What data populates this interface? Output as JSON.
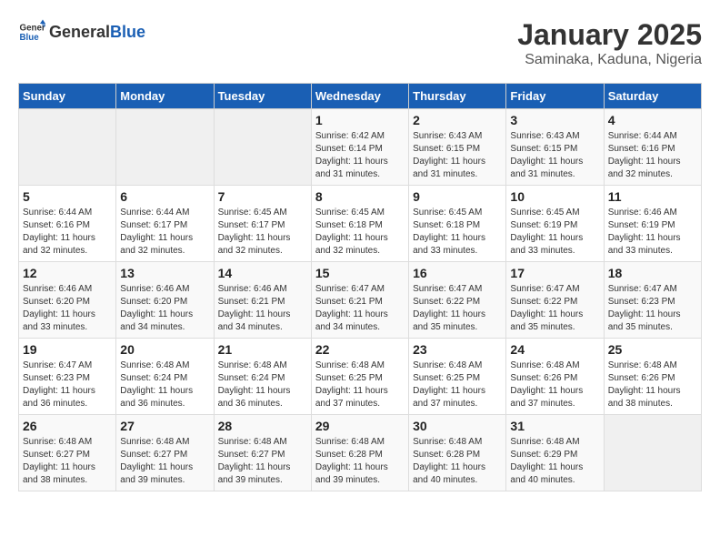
{
  "logo": {
    "text_general": "General",
    "text_blue": "Blue"
  },
  "title": "January 2025",
  "subtitle": "Saminaka, Kaduna, Nigeria",
  "days_of_week": [
    "Sunday",
    "Monday",
    "Tuesday",
    "Wednesday",
    "Thursday",
    "Friday",
    "Saturday"
  ],
  "weeks": [
    [
      {
        "day": "",
        "info": ""
      },
      {
        "day": "",
        "info": ""
      },
      {
        "day": "",
        "info": ""
      },
      {
        "day": "1",
        "info": "Sunrise: 6:42 AM\nSunset: 6:14 PM\nDaylight: 11 hours and 31 minutes."
      },
      {
        "day": "2",
        "info": "Sunrise: 6:43 AM\nSunset: 6:15 PM\nDaylight: 11 hours and 31 minutes."
      },
      {
        "day": "3",
        "info": "Sunrise: 6:43 AM\nSunset: 6:15 PM\nDaylight: 11 hours and 31 minutes."
      },
      {
        "day": "4",
        "info": "Sunrise: 6:44 AM\nSunset: 6:16 PM\nDaylight: 11 hours and 32 minutes."
      }
    ],
    [
      {
        "day": "5",
        "info": "Sunrise: 6:44 AM\nSunset: 6:16 PM\nDaylight: 11 hours and 32 minutes."
      },
      {
        "day": "6",
        "info": "Sunrise: 6:44 AM\nSunset: 6:17 PM\nDaylight: 11 hours and 32 minutes."
      },
      {
        "day": "7",
        "info": "Sunrise: 6:45 AM\nSunset: 6:17 PM\nDaylight: 11 hours and 32 minutes."
      },
      {
        "day": "8",
        "info": "Sunrise: 6:45 AM\nSunset: 6:18 PM\nDaylight: 11 hours and 32 minutes."
      },
      {
        "day": "9",
        "info": "Sunrise: 6:45 AM\nSunset: 6:18 PM\nDaylight: 11 hours and 33 minutes."
      },
      {
        "day": "10",
        "info": "Sunrise: 6:45 AM\nSunset: 6:19 PM\nDaylight: 11 hours and 33 minutes."
      },
      {
        "day": "11",
        "info": "Sunrise: 6:46 AM\nSunset: 6:19 PM\nDaylight: 11 hours and 33 minutes."
      }
    ],
    [
      {
        "day": "12",
        "info": "Sunrise: 6:46 AM\nSunset: 6:20 PM\nDaylight: 11 hours and 33 minutes."
      },
      {
        "day": "13",
        "info": "Sunrise: 6:46 AM\nSunset: 6:20 PM\nDaylight: 11 hours and 34 minutes."
      },
      {
        "day": "14",
        "info": "Sunrise: 6:46 AM\nSunset: 6:21 PM\nDaylight: 11 hours and 34 minutes."
      },
      {
        "day": "15",
        "info": "Sunrise: 6:47 AM\nSunset: 6:21 PM\nDaylight: 11 hours and 34 minutes."
      },
      {
        "day": "16",
        "info": "Sunrise: 6:47 AM\nSunset: 6:22 PM\nDaylight: 11 hours and 35 minutes."
      },
      {
        "day": "17",
        "info": "Sunrise: 6:47 AM\nSunset: 6:22 PM\nDaylight: 11 hours and 35 minutes."
      },
      {
        "day": "18",
        "info": "Sunrise: 6:47 AM\nSunset: 6:23 PM\nDaylight: 11 hours and 35 minutes."
      }
    ],
    [
      {
        "day": "19",
        "info": "Sunrise: 6:47 AM\nSunset: 6:23 PM\nDaylight: 11 hours and 36 minutes."
      },
      {
        "day": "20",
        "info": "Sunrise: 6:48 AM\nSunset: 6:24 PM\nDaylight: 11 hours and 36 minutes."
      },
      {
        "day": "21",
        "info": "Sunrise: 6:48 AM\nSunset: 6:24 PM\nDaylight: 11 hours and 36 minutes."
      },
      {
        "day": "22",
        "info": "Sunrise: 6:48 AM\nSunset: 6:25 PM\nDaylight: 11 hours and 37 minutes."
      },
      {
        "day": "23",
        "info": "Sunrise: 6:48 AM\nSunset: 6:25 PM\nDaylight: 11 hours and 37 minutes."
      },
      {
        "day": "24",
        "info": "Sunrise: 6:48 AM\nSunset: 6:26 PM\nDaylight: 11 hours and 37 minutes."
      },
      {
        "day": "25",
        "info": "Sunrise: 6:48 AM\nSunset: 6:26 PM\nDaylight: 11 hours and 38 minutes."
      }
    ],
    [
      {
        "day": "26",
        "info": "Sunrise: 6:48 AM\nSunset: 6:27 PM\nDaylight: 11 hours and 38 minutes."
      },
      {
        "day": "27",
        "info": "Sunrise: 6:48 AM\nSunset: 6:27 PM\nDaylight: 11 hours and 39 minutes."
      },
      {
        "day": "28",
        "info": "Sunrise: 6:48 AM\nSunset: 6:27 PM\nDaylight: 11 hours and 39 minutes."
      },
      {
        "day": "29",
        "info": "Sunrise: 6:48 AM\nSunset: 6:28 PM\nDaylight: 11 hours and 39 minutes."
      },
      {
        "day": "30",
        "info": "Sunrise: 6:48 AM\nSunset: 6:28 PM\nDaylight: 11 hours and 40 minutes."
      },
      {
        "day": "31",
        "info": "Sunrise: 6:48 AM\nSunset: 6:29 PM\nDaylight: 11 hours and 40 minutes."
      },
      {
        "day": "",
        "info": ""
      }
    ]
  ]
}
